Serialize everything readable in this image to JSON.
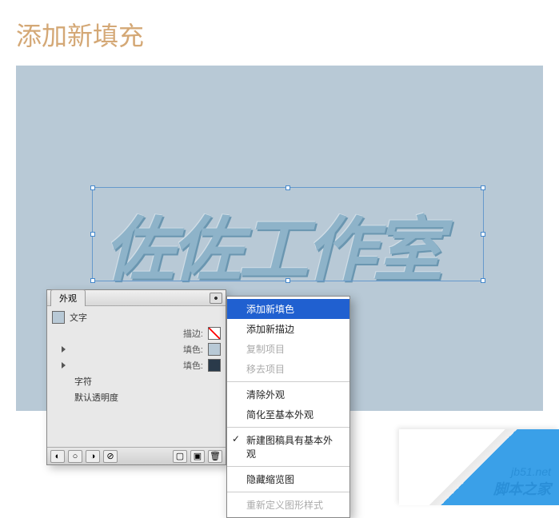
{
  "page_title": "添加新填充",
  "artwork_text": "佐佐工作室",
  "panel": {
    "tab": "外观",
    "type_label": "文字",
    "stroke_label": "描边:",
    "fill1_label": "填色:",
    "fill2_label": "填色:",
    "char_label": "字符",
    "opacity_label": "默认透明度"
  },
  "menu": {
    "items": [
      {
        "label": "添加新填色",
        "state": "selected"
      },
      {
        "label": "添加新描边",
        "state": "normal"
      },
      {
        "label": "复制项目",
        "state": "disabled"
      },
      {
        "label": "移去项目",
        "state": "disabled"
      },
      {
        "sep": true
      },
      {
        "label": "清除外观",
        "state": "normal"
      },
      {
        "label": "简化至基本外观",
        "state": "normal"
      },
      {
        "sep": true
      },
      {
        "label": "新建图稿具有基本外观",
        "state": "normal",
        "checked": true
      },
      {
        "sep": true
      },
      {
        "label": "隐藏缩览图",
        "state": "normal"
      },
      {
        "sep": true
      },
      {
        "label": "重新定义图形样式",
        "state": "disabled"
      }
    ]
  },
  "watermark": {
    "url": "jb51.net",
    "name": "脚本之家"
  }
}
